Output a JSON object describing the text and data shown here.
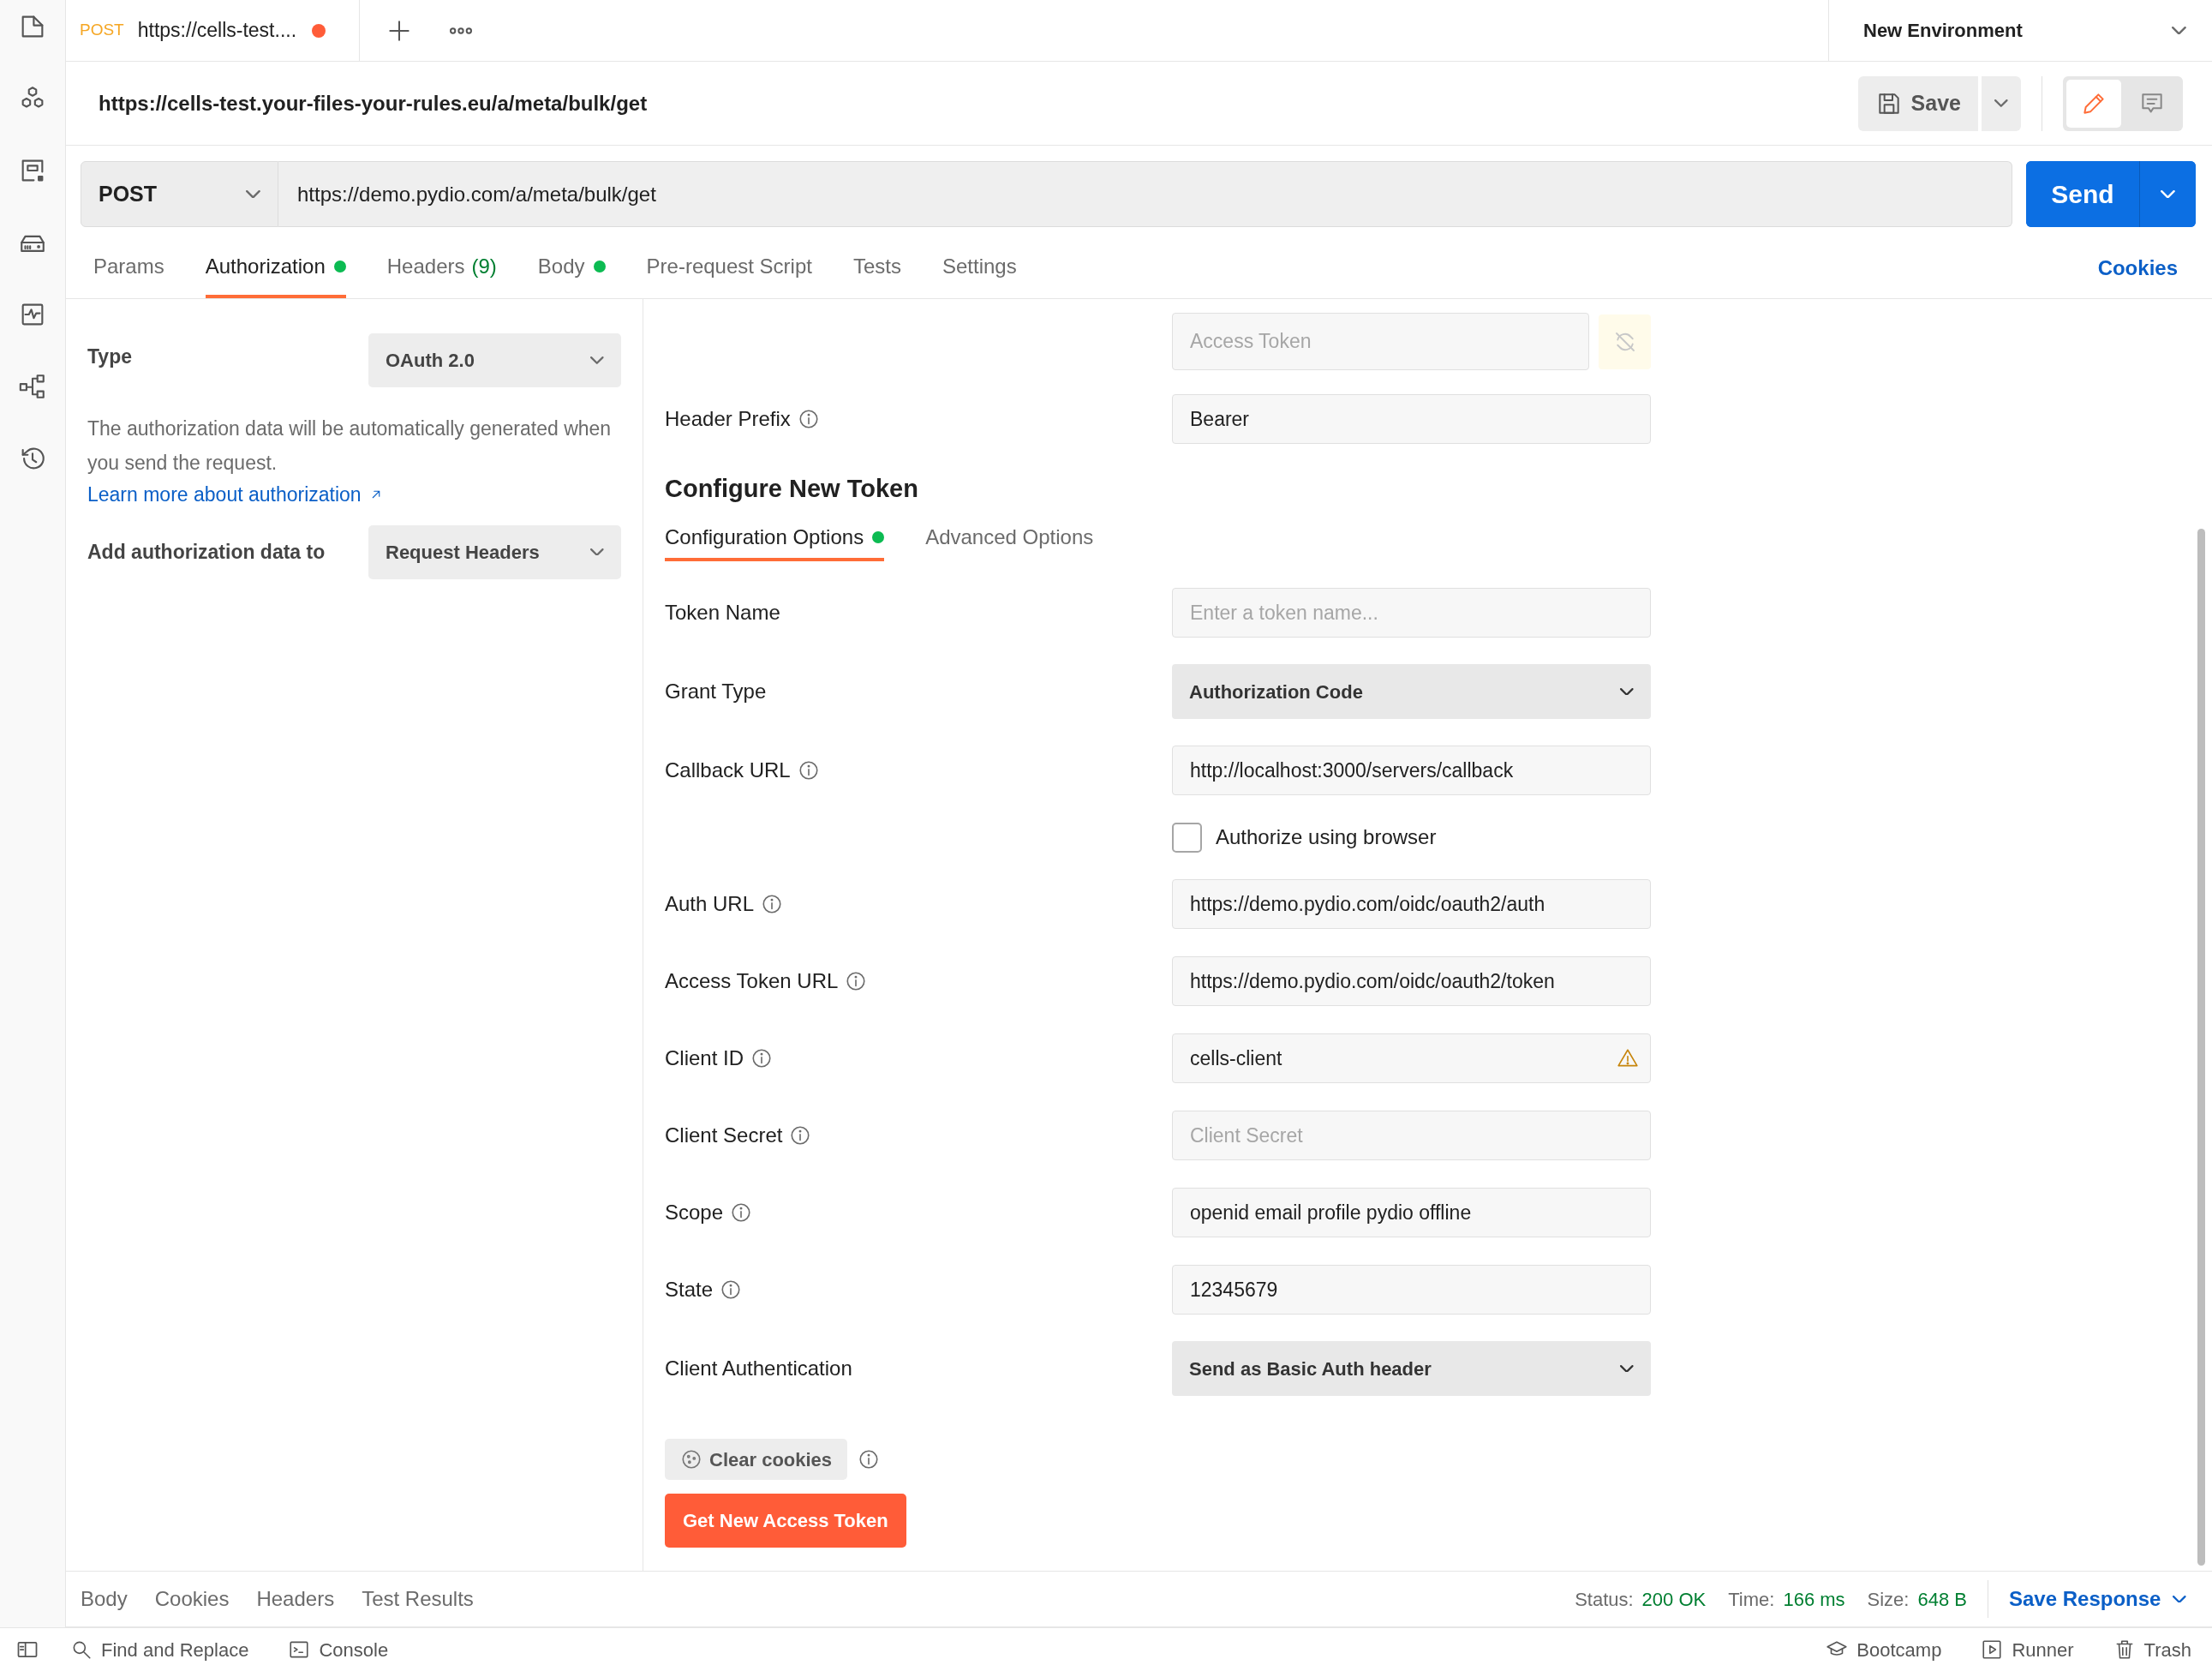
{
  "tab": {
    "method": "POST",
    "title": "https://cells-test....",
    "unsaved": true
  },
  "environment": "New Environment",
  "request_name": "https://cells-test.your-files-your-rules.eu/a/meta/bulk/get",
  "save_button": "Save",
  "mode_toggle": [
    {
      "kind": "edit",
      "selected": true
    },
    {
      "kind": "comments",
      "selected": false
    }
  ],
  "method": "POST",
  "url": "https://demo.pydio.com/a/meta/bulk/get",
  "send_button": "Send",
  "request_tabs": [
    {
      "label": "Params",
      "dot": false,
      "selected": false
    },
    {
      "label": "Authorization",
      "dot": true,
      "selected": true
    },
    {
      "label": "Headers",
      "count": "(9)",
      "dot": false,
      "selected": false
    },
    {
      "label": "Body",
      "dot": true,
      "selected": false
    },
    {
      "label": "Pre-request Script",
      "dot": false,
      "selected": false
    },
    {
      "label": "Tests",
      "dot": false,
      "selected": false
    },
    {
      "label": "Settings",
      "dot": false,
      "selected": false
    }
  ],
  "cookies_link": "Cookies",
  "auth": {
    "type_label": "Type",
    "type_value": "OAuth 2.0",
    "description": "The authorization data will be automatically generated when you send the request.",
    "learn_more": "Learn more about authorization",
    "add_to_label": "Add authorization data to",
    "add_to_value": "Request Headers"
  },
  "access_token": {
    "placeholder": "Access Token"
  },
  "header_prefix": {
    "label": "Header Prefix",
    "info": true,
    "value": "Bearer"
  },
  "configure_title": "Configure New Token",
  "config_tabs": [
    {
      "label": "Configuration Options",
      "dot": true,
      "selected": true
    },
    {
      "label": "Advanced Options",
      "dot": false,
      "selected": false
    }
  ],
  "fields": [
    {
      "kind": "input",
      "label": "Token Name",
      "info": false,
      "placeholder": "Enter a token name...",
      "warning": false
    },
    {
      "kind": "select",
      "label": "Grant Type",
      "info": false,
      "value": "Authorization Code"
    },
    {
      "kind": "input",
      "label": "Callback URL",
      "info": true,
      "value": "http://localhost:3000/servers/callback",
      "warning": false
    },
    {
      "kind": "checkbox",
      "label": "Authorize using browser",
      "checked": false
    },
    {
      "kind": "input",
      "label": "Auth URL",
      "info": true,
      "value": "https://demo.pydio.com/oidc/oauth2/auth",
      "warning": false
    },
    {
      "kind": "input",
      "label": "Access Token URL",
      "info": true,
      "value": "https://demo.pydio.com/oidc/oauth2/token",
      "warning": false
    },
    {
      "kind": "input",
      "label": "Client ID",
      "info": true,
      "value": "cells-client",
      "warning": true
    },
    {
      "kind": "input",
      "label": "Client Secret",
      "info": true,
      "placeholder": "Client Secret",
      "warning": false
    },
    {
      "kind": "input",
      "label": "Scope",
      "info": true,
      "value": "openid email profile pydio offline",
      "warning": false
    },
    {
      "kind": "input",
      "label": "State",
      "info": true,
      "value": "12345679",
      "warning": false
    },
    {
      "kind": "select",
      "label": "Client Authentication",
      "info": false,
      "value": "Send as Basic Auth header"
    }
  ],
  "clear_cookies": "Clear cookies",
  "get_token_button": "Get New Access Token",
  "response_tabs": [
    "Body",
    "Cookies",
    "Headers",
    "Test Results"
  ],
  "response_stats": [
    {
      "label": "Status:",
      "value": "200 OK"
    },
    {
      "label": "Time:",
      "value": "166 ms"
    },
    {
      "label": "Size:",
      "value": "648 B"
    }
  ],
  "save_response": "Save Response",
  "footer_left": [
    {
      "kind": "search",
      "label": "Find and Replace"
    },
    {
      "kind": "console",
      "label": "Console"
    }
  ],
  "footer_right": [
    {
      "kind": "bootcamp",
      "label": "Bootcamp"
    },
    {
      "kind": "runner",
      "label": "Runner"
    },
    {
      "kind": "trash",
      "label": "Trash"
    }
  ]
}
